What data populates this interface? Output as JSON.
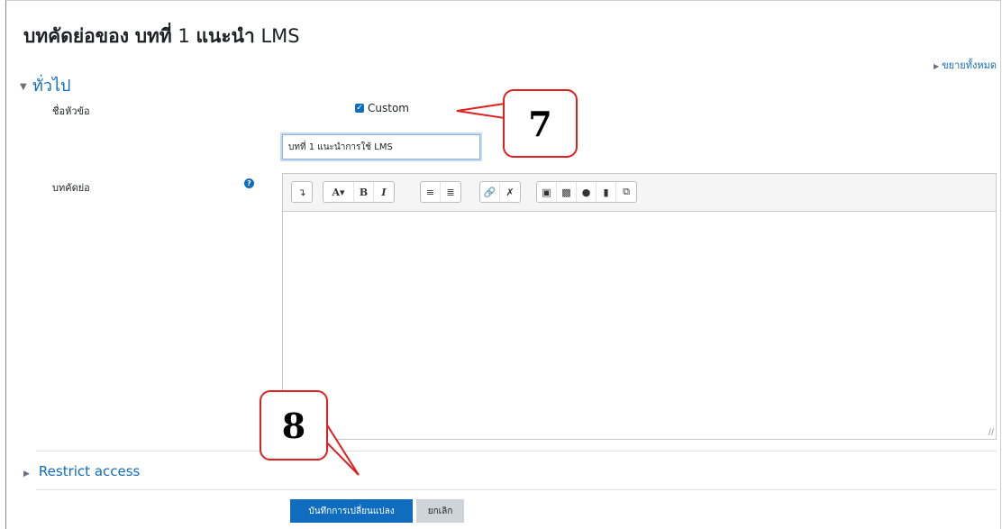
{
  "page": {
    "title_bold_1": "บทคัดย่อของ",
    "title_bold_2": "บทที่",
    "title_num": "1",
    "title_bold_3": "แนะนำ",
    "title_suffix": "LMS",
    "expand_all": "ขยายทั้งหมด"
  },
  "general": {
    "heading": "ทั่วไป",
    "section_name_label": "ชื่อหัวข้อ",
    "custom_label": "Custom",
    "custom_checked": true,
    "section_name_value": "บทที่ 1 แนะนำการใช้ LMS",
    "summary_label": "บทคัดย่อ"
  },
  "editor": {
    "toolbar": [
      "show-more-icon",
      "font-color-icon",
      "bold-icon",
      "italic-icon",
      "unordered-list-icon",
      "ordered-list-icon",
      "link-icon",
      "unlink-icon",
      "image-icon",
      "media-icon",
      "record-audio-icon",
      "record-video-icon",
      "manage-files-icon"
    ],
    "content": ""
  },
  "restrict": {
    "heading": "Restrict access"
  },
  "actions": {
    "save": "บันทึกการเปลี่ยนแปลง",
    "cancel": "ยกเลิก"
  },
  "callouts": {
    "first": "7",
    "second": "8"
  },
  "colors": {
    "link": "#0f6cbf",
    "primary_button": "#0f6cbf",
    "callout_border": "#e02020"
  }
}
